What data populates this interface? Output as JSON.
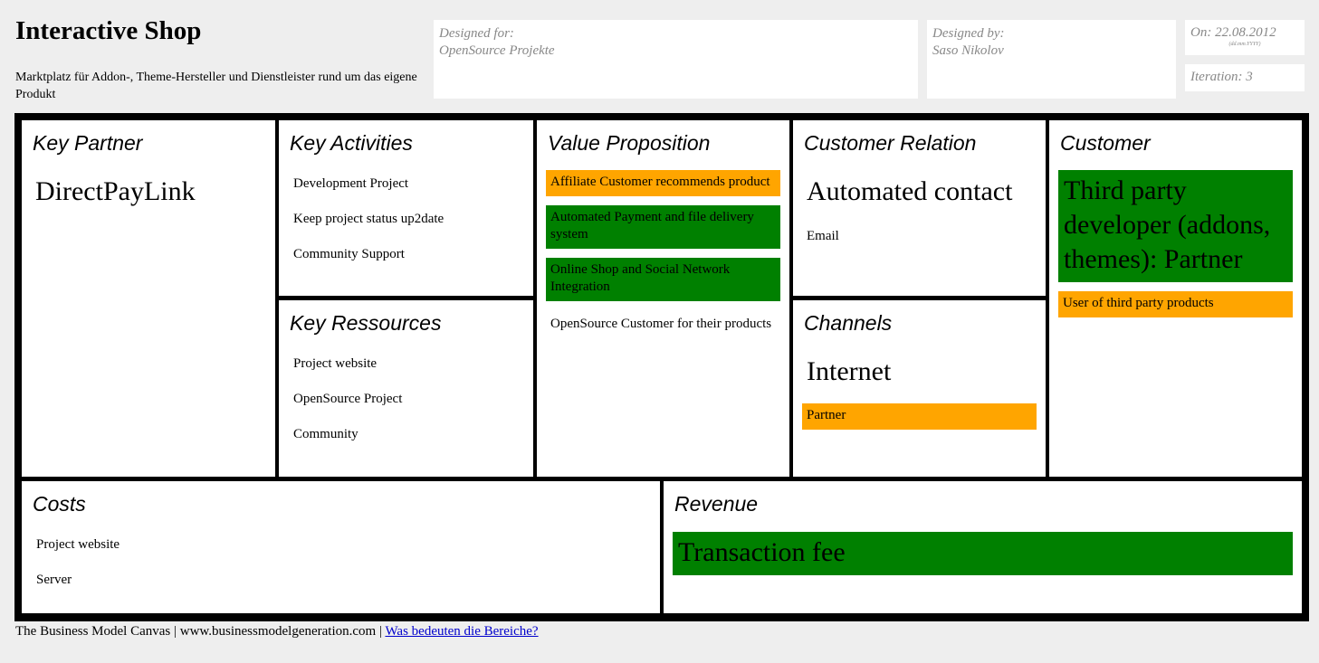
{
  "header": {
    "title": "Interactive Shop",
    "subtitle": "Marktplatz für Addon-, Theme-Hersteller und Dienstleister rund um das eigene Produkt"
  },
  "meta": {
    "designed_for_label": "Designed for:",
    "designed_for_value": "OpenSource Projekte",
    "designed_by_label": "Designed by:",
    "designed_by_value": "Saso Nikolov",
    "date": "On: 22.08.2012",
    "date_format": "(dd.mm.YYYY)",
    "iteration": "Iteration: 3"
  },
  "canvas": {
    "key_partner": {
      "title": "Key Partner",
      "big_item": "DirectPayLink"
    },
    "key_activities": {
      "title": "Key Activities",
      "items": [
        "Development Project",
        "Keep project status up2date",
        "Community Support"
      ]
    },
    "key_resources": {
      "title": "Key Ressources",
      "items": [
        "Project website",
        "OpenSource Project",
        "Community"
      ]
    },
    "value_proposition": {
      "title": "Value Proposition",
      "notes": [
        {
          "text": "Affiliate Customer recommends product",
          "color": "#ffa500"
        },
        {
          "text": "Automated Payment and file delivery system",
          "color": "#008000"
        },
        {
          "text": "Online Shop and Social Network Integration",
          "color": "#008000"
        }
      ],
      "plain_item": "OpenSource Customer for their products"
    },
    "customer_relation": {
      "title": "Customer Relation",
      "big_item": "Automated contact",
      "items": [
        "Email"
      ]
    },
    "channels": {
      "title": "Channels",
      "big_item": "Internet",
      "notes": [
        {
          "text": "Partner",
          "color": "#ffa500"
        }
      ]
    },
    "customer": {
      "title": "Customer",
      "big_note": {
        "text": "Third party developer (addons, themes): Partner",
        "color": "#008000"
      },
      "notes": [
        {
          "text": "User of third party products",
          "color": "#ffa500"
        }
      ]
    },
    "costs": {
      "title": "Costs",
      "items": [
        "Project website",
        "Server"
      ]
    },
    "revenue": {
      "title": "Revenue",
      "big_note": {
        "text": "Transaction fee",
        "color": "#008000"
      }
    }
  },
  "footer": {
    "text": "The Business Model Canvas | www.businessmodelgeneration.com | ",
    "link": "Was bedeuten die Bereiche?"
  }
}
